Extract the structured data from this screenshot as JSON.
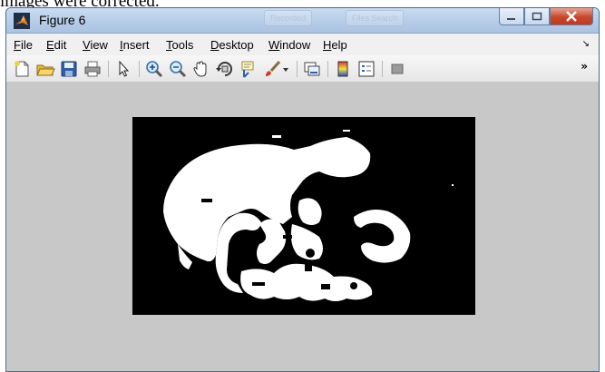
{
  "caption": "images were corrected.",
  "window": {
    "title": "Figure 6",
    "ghost_buttons": [
      "Recorded",
      "Files Search"
    ],
    "controls": {
      "minimize": "minimize-icon",
      "maximize": "maximize-icon",
      "close": "close-icon"
    }
  },
  "menu": {
    "items": [
      {
        "accel": "F",
        "rest": "ile"
      },
      {
        "accel": "E",
        "rest": "dit"
      },
      {
        "accel": "V",
        "rest": "iew"
      },
      {
        "accel": "I",
        "rest": "nsert"
      },
      {
        "accel": "T",
        "rest": "ools"
      },
      {
        "accel": "D",
        "rest": "esktop"
      },
      {
        "accel": "W",
        "rest": "indow"
      },
      {
        "accel": "H",
        "rest": "elp"
      }
    ],
    "dock_glyph": "↘"
  },
  "toolbar": {
    "icons": [
      "new-figure-icon",
      "open-file-icon",
      "save-icon",
      "print-icon",
      "edit-plot-arrow-icon",
      "zoom-in-icon",
      "zoom-out-icon",
      "pan-hand-icon",
      "rotate-3d-icon",
      "data-cursor-icon",
      "brush-icon",
      "brush-dropdown-icon",
      "link-plot-icon",
      "colorbar-icon",
      "legend-icon",
      "plot-tools-icon"
    ],
    "more_glyph": "»"
  },
  "colors": {
    "figure_bg": "#c8c8c8",
    "axes_bg": "#000000",
    "segment": "#ffffff",
    "titlebar": "#b6cde8",
    "close_red": "#c8472b"
  }
}
